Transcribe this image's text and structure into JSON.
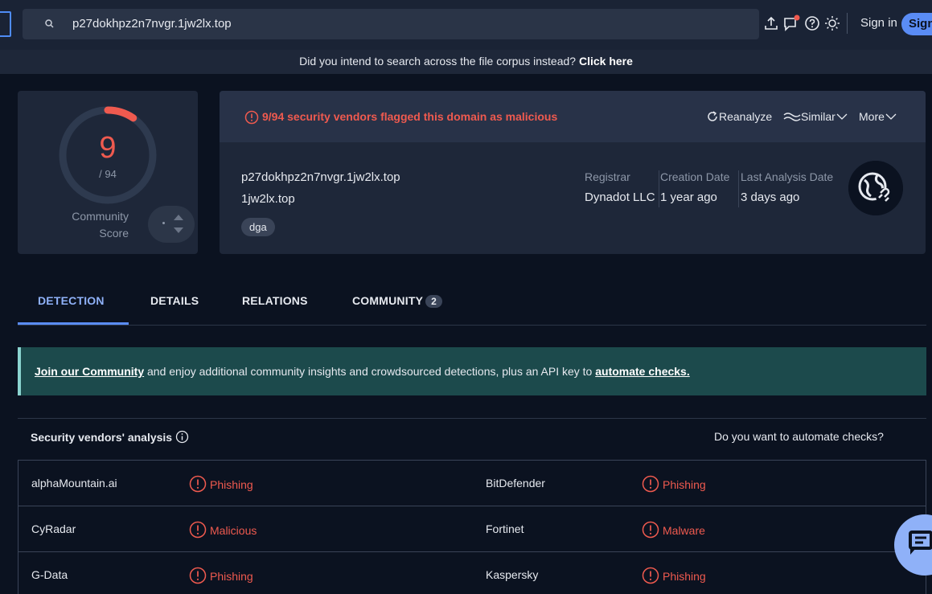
{
  "search": {
    "query": "p27dokhpz2n7nvgr.1jw2lx.top"
  },
  "header": {
    "signin_label": "Sign in",
    "signup_label": "Sign"
  },
  "notice": {
    "text": "Did you intend to search across the file corpus instead? ",
    "link": "Click here"
  },
  "score": {
    "value": "9",
    "denominator": "/ 94",
    "malicious_fraction": 0.0957,
    "community_label_line1": "Community",
    "community_label_line2": "Score"
  },
  "summary": {
    "flag_text": "9/94 security vendors flagged this domain as malicious",
    "actions": {
      "reanalyze": "Reanalyze",
      "similar": "Similar",
      "more": "More"
    },
    "domain": "p27dokhpz2n7nvgr.1jw2lx.top",
    "parent_domain": "1jw2lx.top",
    "tag": "dga",
    "meta": [
      {
        "label": "Registrar",
        "value": "Dynadot LLC"
      },
      {
        "label": "Creation Date",
        "value": "1 year ago"
      },
      {
        "label": "Last Analysis Date",
        "value": "3 days ago"
      }
    ]
  },
  "tabs": [
    {
      "label": "DETECTION",
      "active": true
    },
    {
      "label": "DETAILS"
    },
    {
      "label": "RELATIONS"
    },
    {
      "label": "COMMUNITY",
      "badge": "2"
    }
  ],
  "banner": {
    "join_link": "Join our Community",
    "middle": " and enjoy additional community insights and crowdsourced detections, plus an API key to ",
    "automate_link": "automate checks."
  },
  "vendors": {
    "title": "Security vendors' analysis",
    "right_text": "Do you want to automate checks?",
    "rows": [
      {
        "left_vendor": "alphaMountain.ai",
        "left_result": "Phishing",
        "right_vendor": "BitDefender",
        "right_result": "Phishing"
      },
      {
        "left_vendor": "CyRadar",
        "left_result": "Malicious",
        "right_vendor": "Fortinet",
        "right_result": "Malware"
      },
      {
        "left_vendor": "G-Data",
        "left_result": "Phishing",
        "right_vendor": "Kaspersky",
        "right_result": "Phishing"
      }
    ]
  },
  "colors": {
    "accent": "#5a8cf5",
    "danger": "#ef5a4f",
    "banner": "#1c4a4c",
    "background": "#0b1220"
  }
}
